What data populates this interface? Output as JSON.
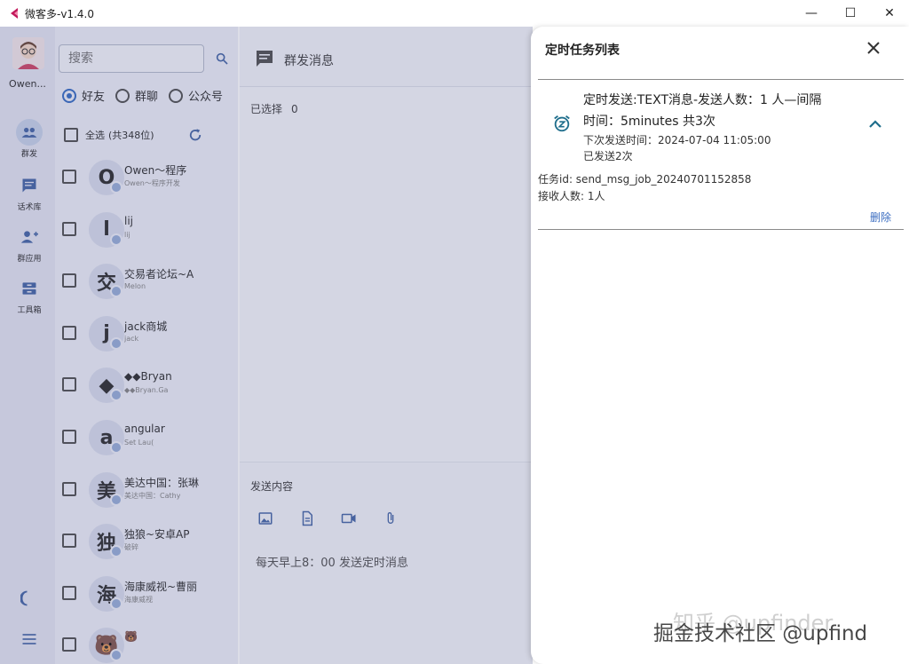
{
  "window": {
    "title": "微客多-v1.4.0",
    "controls": [
      "—",
      "☐",
      "✕"
    ]
  },
  "rail": {
    "user_name": "Owen...",
    "items": [
      {
        "label": "群发",
        "icon": "group-icon",
        "active": true
      },
      {
        "label": "话术库",
        "icon": "chat-bubble-icon",
        "active": false
      },
      {
        "label": "群应用",
        "icon": "person-add-icon",
        "active": false
      },
      {
        "label": "工具箱",
        "icon": "toolbox-icon",
        "active": false
      }
    ],
    "bottom": [
      "dark-mode-icon",
      "menu-icon"
    ]
  },
  "contacts": {
    "search_placeholder": "搜索",
    "filters": [
      {
        "label": "好友",
        "selected": true
      },
      {
        "label": "群聊",
        "selected": false
      },
      {
        "label": "公众号",
        "selected": false
      }
    ],
    "select_all": "全选",
    "total": "(共348位)",
    "list": [
      {
        "initial": "O",
        "name": "Owen～程序",
        "sub": "Owen～程序开发"
      },
      {
        "initial": "l",
        "name": "lij",
        "sub": "lij"
      },
      {
        "initial": "交",
        "name": "交易者论坛~A",
        "sub": "Melon"
      },
      {
        "initial": "j",
        "name": "jack商城",
        "sub": "jack"
      },
      {
        "initial": "◆",
        "name": "◆◆Bryan",
        "sub": "◆◆Bryan.Ga"
      },
      {
        "initial": "a",
        "name": "angular",
        "sub": "Set Lau("
      },
      {
        "initial": "美",
        "name": "美达中国：张琳",
        "sub": "美达中国：Cathy"
      },
      {
        "initial": "独",
        "name": "独狼~安卓AP",
        "sub": "破碎"
      },
      {
        "initial": "海",
        "name": "海康威视~曹丽",
        "sub": "海康威视"
      },
      {
        "initial": "🐻",
        "name": "🐻",
        "sub": ""
      }
    ]
  },
  "middle": {
    "header_title": "群发消息",
    "selected_label": "已选择",
    "selected_count": "0",
    "compose_label": "发送内容",
    "tools": [
      "image-icon",
      "file-icon",
      "video-icon",
      "attachment-icon"
    ],
    "compose_text": "每天早上8：00 发送定时消息"
  },
  "drawer": {
    "title": "定时任务列表",
    "task": {
      "line1": "定时发送:TEXT消息-发送人数：1 人—间隔",
      "line2": "时间：5minutes 共3次",
      "next_send": "下次发送时间：2024-07-04 11:05:00",
      "sent": "已发送2次",
      "id": "任务id:  send_msg_job_20240701152858",
      "receivers": "接收人数:  1人",
      "delete_label": "删除"
    }
  },
  "watermark": {
    "faint": "知乎 @upfinder",
    "main": "掘金技术社区 @upfind"
  },
  "colors": {
    "accent": "#3b6fc4",
    "rail_bg": "#e4e6f2",
    "list_bg": "#eef0f8",
    "icon": "#4a6aa8"
  }
}
